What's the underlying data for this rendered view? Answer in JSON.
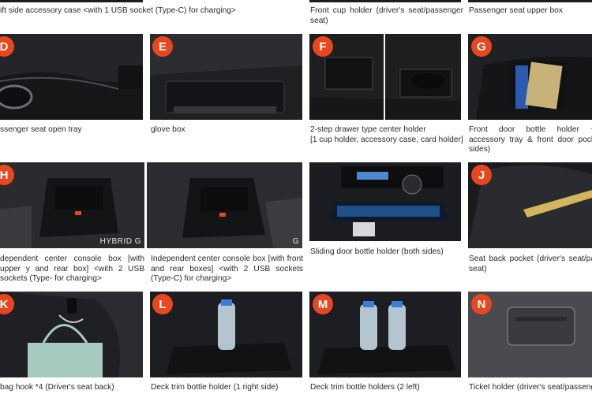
{
  "top_row": {
    "caption_a": "ift side accessory case <with 1 USB socket (Type-C) for charging>",
    "caption_b": "Front cup holder (driver's seat/passenger seat)",
    "caption_c": "Passenger seat upper box"
  },
  "items": [
    {
      "badge": "D",
      "caption": "ssenger seat open tray"
    },
    {
      "badge": "E",
      "caption": "glove box"
    },
    {
      "badge": "F",
      "caption": "2-step drawer type center holder\n[1 cup holder, accessory case, card holder]"
    },
    {
      "badge": "G",
      "caption": "Front door bottle holder + accessory tray & front door pock sides)"
    },
    {
      "badge": "H",
      "caption": "dependent center console box [with upper y and rear box] <with 2 USB sockets (Type- for charging>",
      "tag": "HYBRID G"
    },
    {
      "caption": "Independent center console box [with front and rear boxes] <with 2 USB sockets (Type-C) for charging>",
      "tag": "G"
    },
    {
      "caption": "Sliding door bottle holder (both sides)"
    },
    {
      "badge": "J",
      "caption": "Seat back pocket (driver's seat/pa seat)"
    },
    {
      "badge": "K",
      "caption": "bag hook *4 (Driver's seat back)"
    },
    {
      "badge": "L",
      "caption": "Deck trim bottle holder (1 right side)"
    },
    {
      "badge": "M",
      "caption": "Deck trim bottle holders (2 left)"
    },
    {
      "badge": "N",
      "caption": "Ticket holder (driver's seat/passeng"
    }
  ],
  "colors": {
    "badge": "#e8461e",
    "interior": "#1b1c1e",
    "ambient_blue": "#2f7bd8",
    "page": "#ffffff"
  }
}
